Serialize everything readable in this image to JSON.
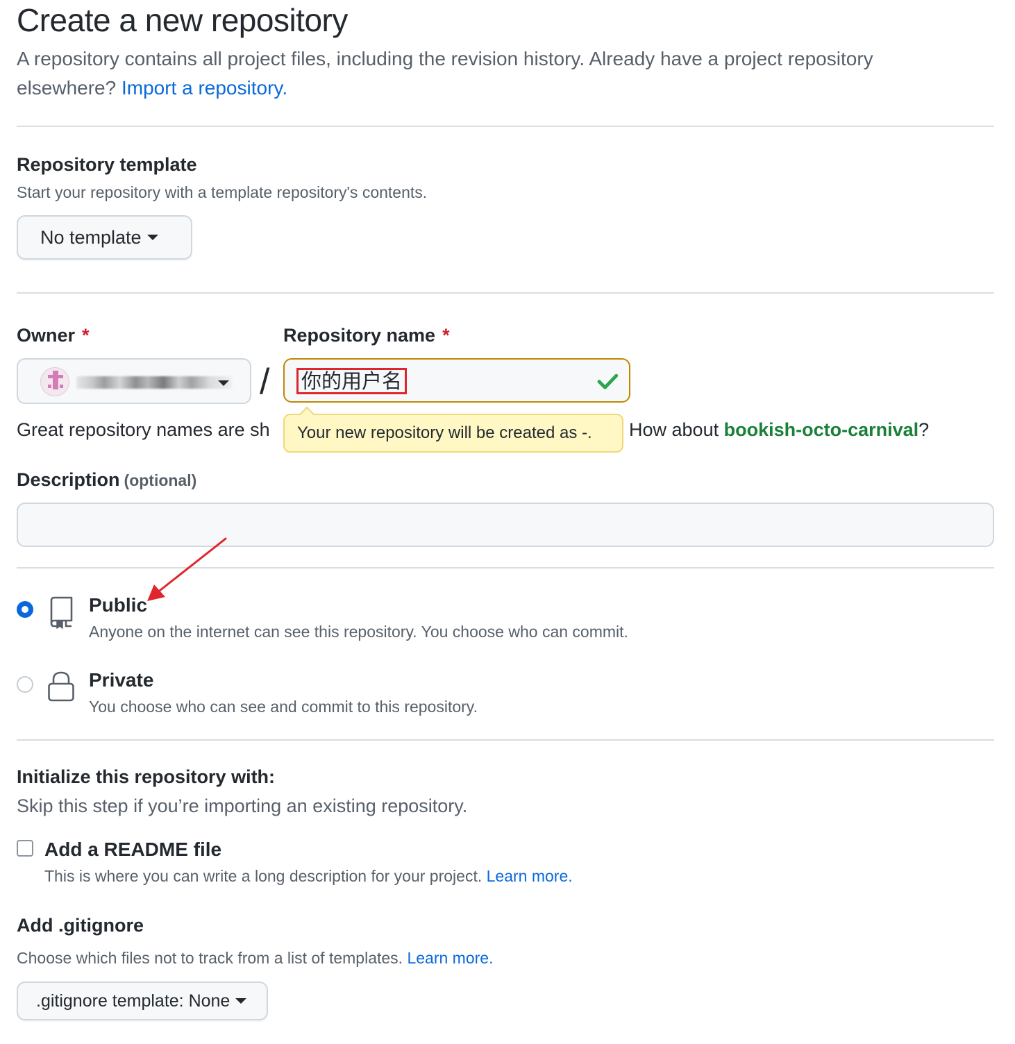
{
  "header": {
    "title": "Create a new repository",
    "intro": "A repository contains all project files, including the revision history. Already have a project repository elsewhere?",
    "import_link": "Import a repository."
  },
  "template": {
    "heading": "Repository template",
    "note": "Start your repository with a template repository's contents.",
    "button_label": "No template"
  },
  "owner": {
    "label": "Owner",
    "required_mark": "*",
    "icon": "chevron-down-icon"
  },
  "slash": "/",
  "repo_name": {
    "label": "Repository name",
    "required_mark": "*",
    "value": "你的用户名",
    "status_icon": "check-icon",
    "status_color": "#2da44e"
  },
  "naming_hint": {
    "prefix": "Great repository names are sh",
    "tooltip": "Your new repository will be created as -.",
    "how_about": "How about ",
    "suggestion": "bookish-octo-carnival",
    "suffix": "?"
  },
  "description": {
    "label": "Description",
    "optional": "(optional)",
    "value": ""
  },
  "visibility": {
    "selected": "public",
    "public": {
      "title": "Public",
      "desc": "Anyone on the internet can see this repository. You choose who can commit.",
      "icon": "repo-icon"
    },
    "private": {
      "title": "Private",
      "desc": "You choose who can see and commit to this repository.",
      "icon": "lock-icon"
    }
  },
  "initialize": {
    "heading": "Initialize this repository with:",
    "note": "Skip this step if you’re importing an existing repository.",
    "readme": {
      "label": "Add a README file",
      "checked": false,
      "desc": "This is where you can write a long description for your project.",
      "learn_more": "Learn more."
    }
  },
  "gitignore": {
    "heading": "Add .gitignore",
    "note": "Choose which files not to track from a list of templates.",
    "learn_more": "Learn more.",
    "button_label": ".gitignore template: None"
  },
  "colors": {
    "accent": "#0969da",
    "danger": "#cf222e",
    "success": "#1a7f37",
    "annotation": "#e0262d",
    "warning_border": "#bf8700",
    "tooltip_bg": "#fff8c5"
  }
}
